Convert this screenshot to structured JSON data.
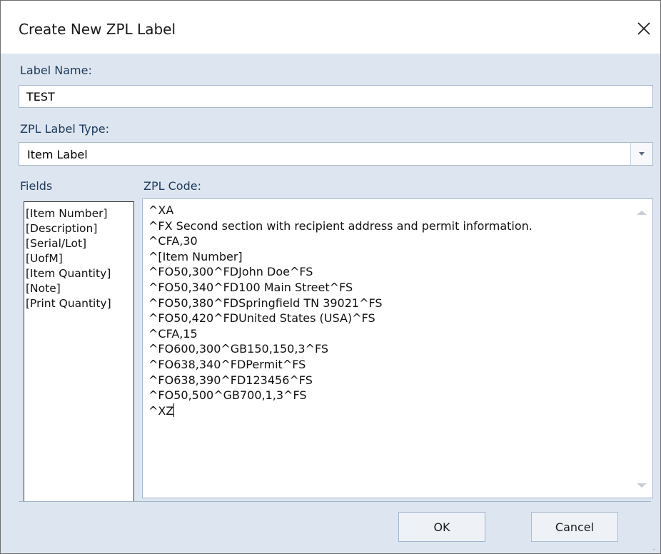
{
  "window": {
    "title": "Create New ZPL Label",
    "close_icon": "close-icon"
  },
  "label_name": {
    "label": "Label Name:",
    "value": "TEST"
  },
  "label_type": {
    "label": "ZPL Label Type:",
    "selected": "Item Label"
  },
  "fields": {
    "label": "Fields",
    "items": [
      "[Item Number]",
      "[Description]",
      "[Serial/Lot]",
      "[UofM]",
      "[Item Quantity]",
      "[Note]",
      "[Print Quantity]"
    ]
  },
  "zpl_code": {
    "label": "ZPL Code:",
    "lines": [
      "^XA",
      "^FX Second section with recipient address and permit information.",
      "^CFA,30",
      "^[Item Number]",
      "^FO50,300^FDJohn Doe^FS",
      "^FO50,340^FD100 Main Street^FS",
      "^FO50,380^FDSpringfield TN 39021^FS",
      "^FO50,420^FDUnited States (USA)^FS",
      "^CFA,15",
      "^FO600,300^GB150,150,3^FS",
      "^FO638,340^FDPermit^FS",
      "^FO638,390^FD123456^FS",
      "^FO50,500^GB700,1,3^FS",
      "^XZ"
    ]
  },
  "buttons": {
    "ok": "OK",
    "cancel": "Cancel"
  },
  "colors": {
    "client_bg": "#dde6f0",
    "label_text": "#1e395b",
    "border": "#a7b7cc"
  }
}
